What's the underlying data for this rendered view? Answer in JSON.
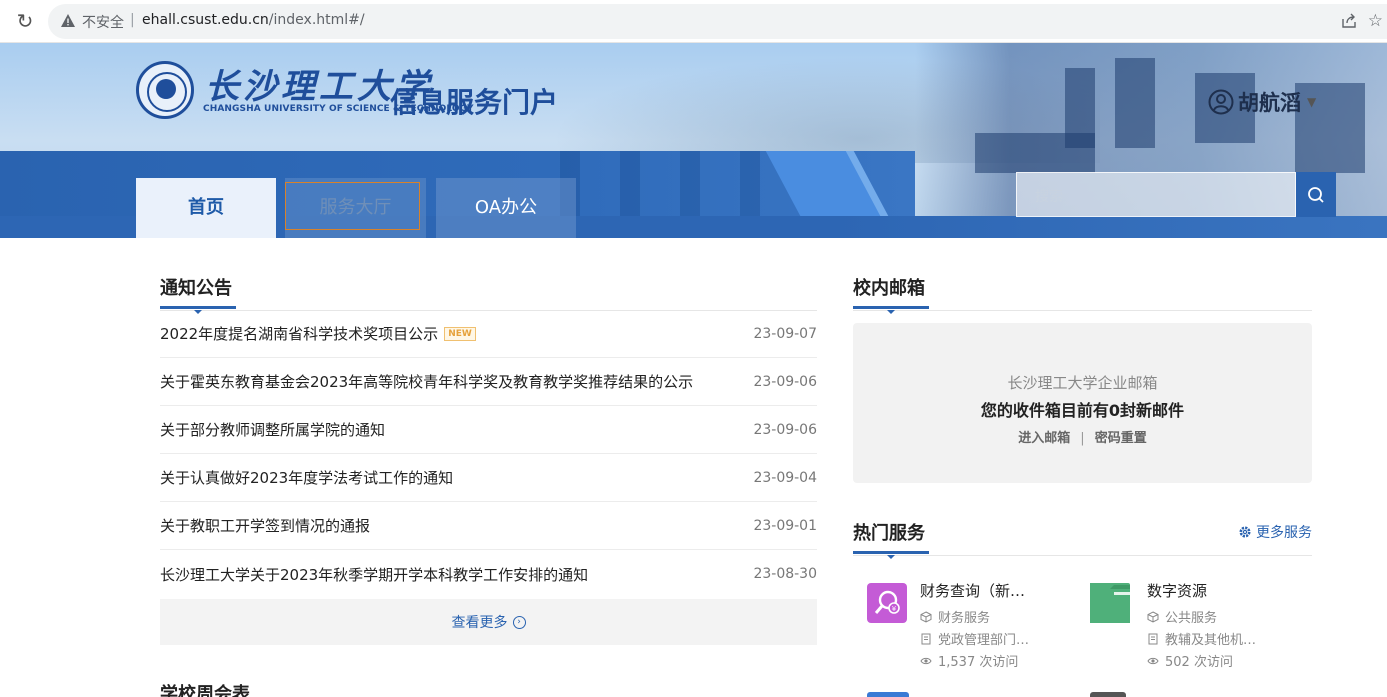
{
  "browser": {
    "security_label": "不安全",
    "url_host": "ehall.csust.edu.cn",
    "url_path": "/index.html#/"
  },
  "header": {
    "logo_cn": "长沙理工大学",
    "logo_en": "CHANGSHA UNIVERSITY OF SCIENCE & TECHNOLOGY",
    "portal_title": "信息服务门户",
    "user_name": "胡航滔",
    "search_placeholder": "搜索"
  },
  "nav": {
    "tabs": [
      {
        "label": "首页"
      },
      {
        "label": "服务大厅"
      },
      {
        "label": "OA办公"
      }
    ]
  },
  "notices": {
    "title": "通知公告",
    "new_badge": "NEW",
    "items": [
      {
        "title": "2022年度提名湖南省科学技术奖项目公示",
        "date": "23-09-07"
      },
      {
        "title": "关于霍英东教育基金会2023年高等院校青年科学奖及教育教学奖推荐结果的公示",
        "date": "23-09-06"
      },
      {
        "title": "关于部分教师调整所属学院的通知",
        "date": "23-09-06"
      },
      {
        "title": "关于认真做好2023年度学法考试工作的通知",
        "date": "23-09-04"
      },
      {
        "title": "关于教职工开学签到情况的通报",
        "date": "23-09-01"
      },
      {
        "title": "长沙理工大学关于2023年秋季学期开学本科教学工作安排的通知",
        "date": "23-08-30"
      }
    ],
    "more_label": "查看更多"
  },
  "weekly": {
    "title": "学校周会表"
  },
  "mailbox": {
    "title": "校内邮箱",
    "provider": "长沙理工大学企业邮箱",
    "status": "您的收件箱目前有0封新邮件",
    "enter_label": "进入邮箱",
    "reset_label": "密码重置"
  },
  "hot_services": {
    "title": "热门服务",
    "more_label": "更多服务",
    "items": [
      {
        "name": "财务查询（新…",
        "category": "财务服务",
        "department": "党政管理部门…",
        "visits": "1,537 次访问",
        "icon": "search-money-icon",
        "color": "#c45bd6"
      },
      {
        "name": "数字资源",
        "category": "公共服务",
        "department": "教辅及其他机…",
        "visits": "502 次访问",
        "icon": "folder-icon",
        "color": "#4fb07a"
      }
    ]
  },
  "colors": {
    "brand": "#2a63b0",
    "accent_new": "#e6a23c"
  }
}
